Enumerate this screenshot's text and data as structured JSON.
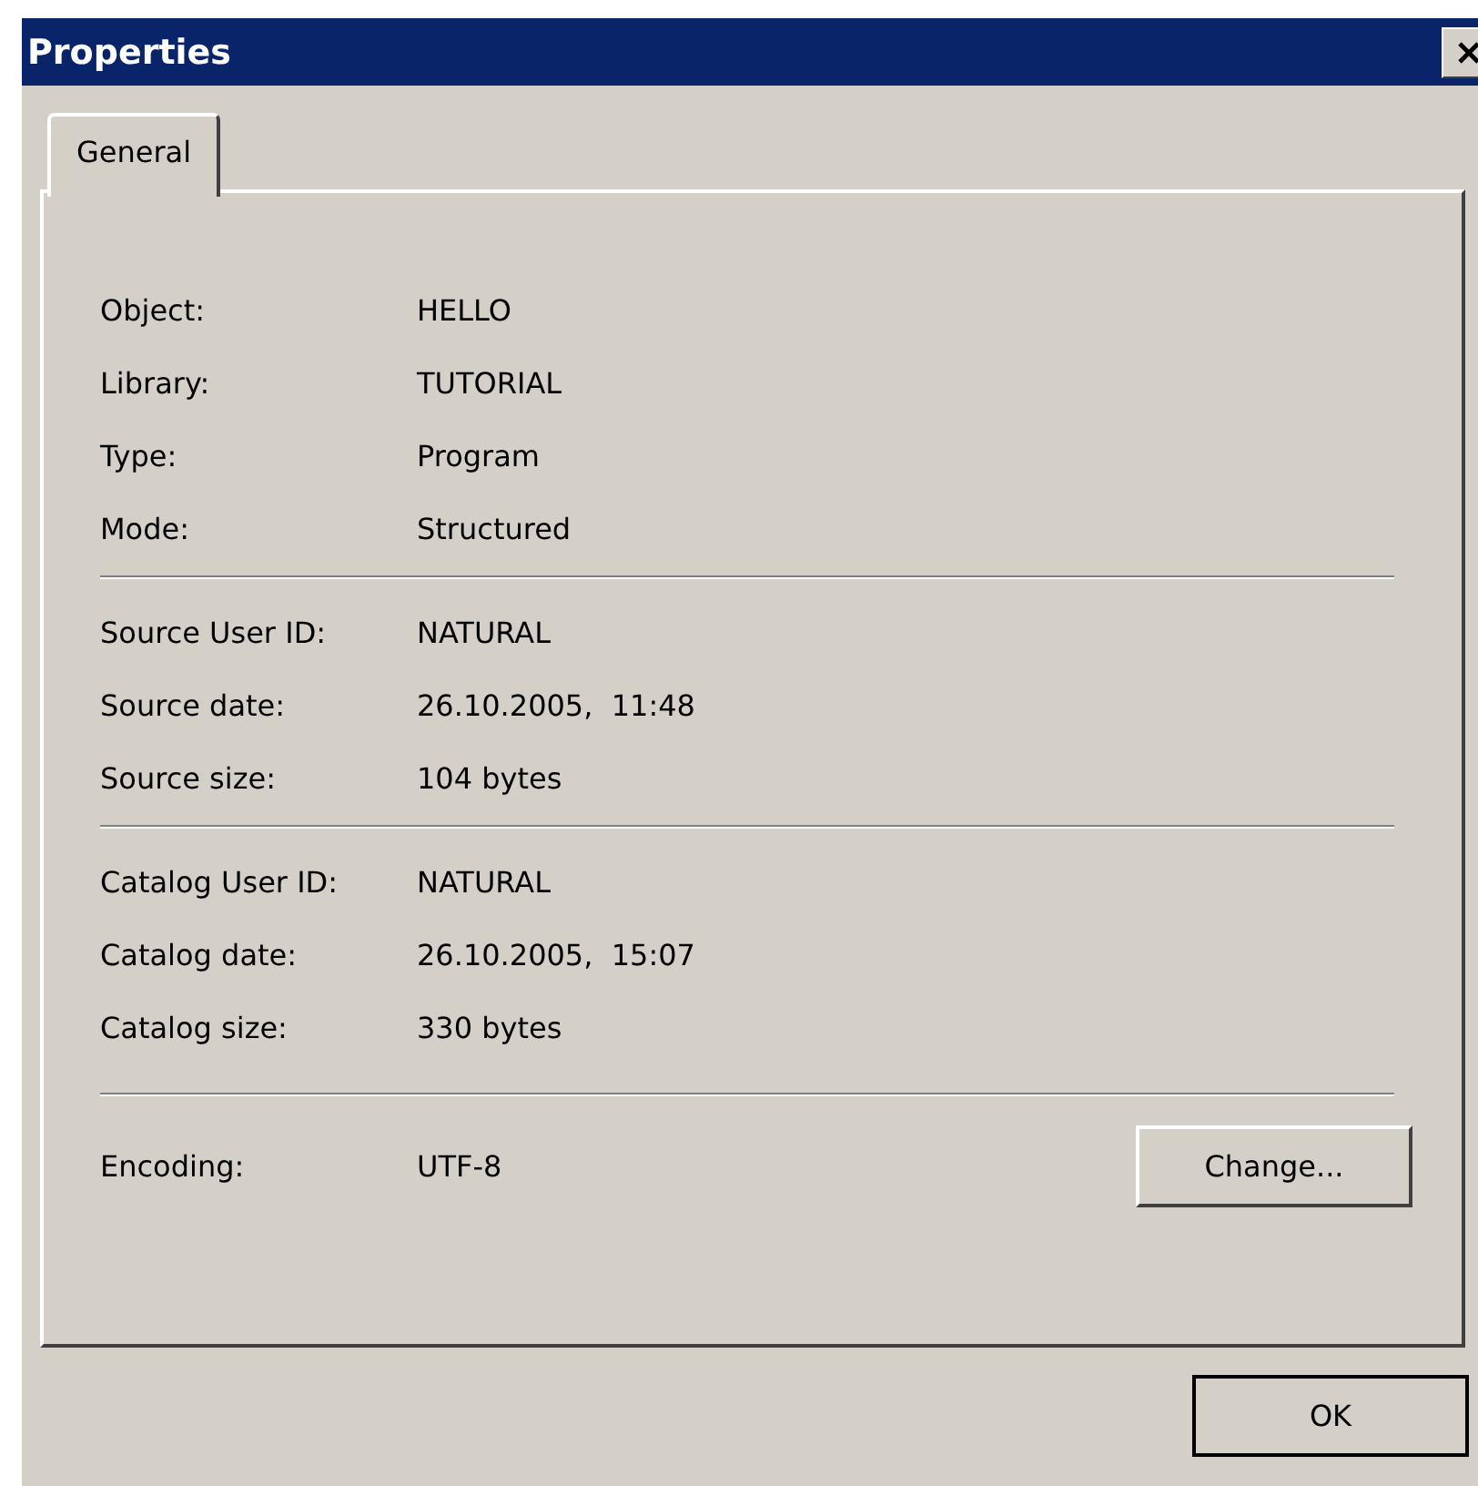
{
  "window": {
    "title": "Properties"
  },
  "tabs": [
    {
      "label": "General",
      "selected": true
    }
  ],
  "sections": [
    {
      "fields": [
        {
          "label": "Object:",
          "value": "HELLO"
        },
        {
          "label": "Library:",
          "value": "TUTORIAL"
        },
        {
          "label": "Type:",
          "value": "Program"
        },
        {
          "label": "Mode:",
          "value": "Structured"
        }
      ]
    },
    {
      "fields": [
        {
          "label": "Source User ID:",
          "value": "NATURAL"
        },
        {
          "label": "Source date:",
          "value": "26.10.2005,  11:48"
        },
        {
          "label": "Source size:",
          "value": "104 bytes"
        }
      ]
    },
    {
      "fields": [
        {
          "label": "Catalog User ID:",
          "value": "NATURAL"
        },
        {
          "label": "Catalog date:",
          "value": "26.10.2005,  15:07"
        },
        {
          "label": "Catalog size:",
          "value": "330 bytes"
        }
      ]
    },
    {
      "fields": [
        {
          "label": "Encoding:",
          "value": "UTF-8"
        }
      ],
      "button": "Change..."
    }
  ],
  "buttons": [
    "OK"
  ]
}
